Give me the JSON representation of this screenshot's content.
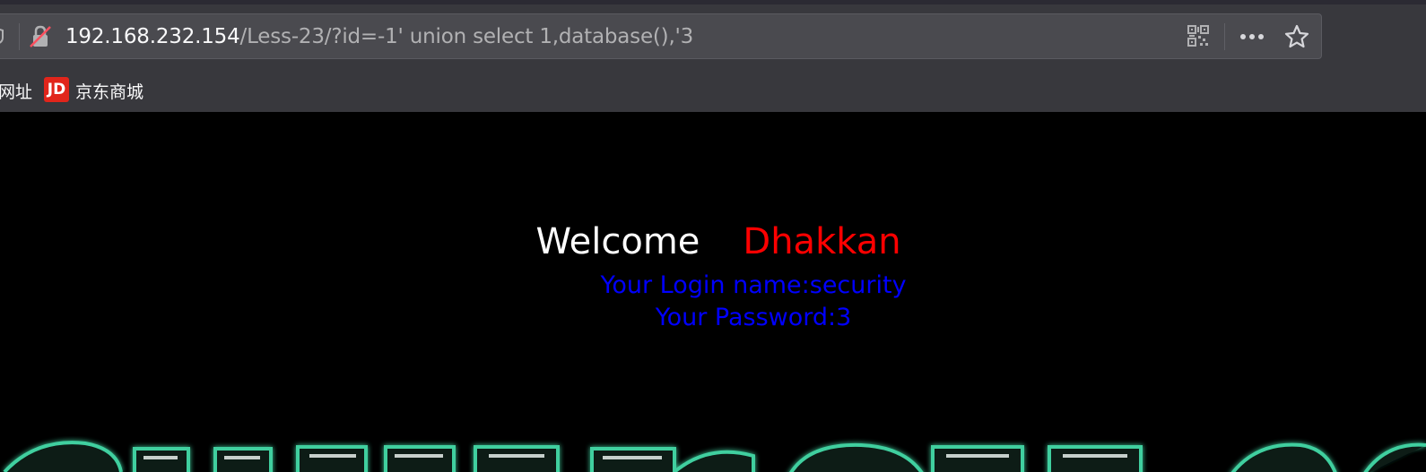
{
  "browser": {
    "url_host": "192.168.232.154",
    "url_rest": "/Less-23/?id=-1' union select 1,database(),'3",
    "icons": {
      "lock": "insecure-lock-icon",
      "qr": "qr-code-icon",
      "more": "more-actions-icon",
      "star": "bookmark-star-icon"
    },
    "bookmarks": {
      "partial_label": "网址",
      "jd_icon_text": "JD",
      "jd_label": "京东商城"
    },
    "colors": {
      "chrome_bg": "#38383d",
      "urlbar_bg": "#4a4a4f",
      "jd_red": "#e1251b"
    }
  },
  "page": {
    "welcome_label": "Welcome",
    "username": "Dhakkan",
    "login_name_line": "Your Login name:security",
    "password_line": "Your Password:3",
    "colors": {
      "background": "#000000",
      "welcome": "#ffffff",
      "username": "#ff0000",
      "info": "#0000ff",
      "banner_glow": "#3fcf9f"
    }
  }
}
